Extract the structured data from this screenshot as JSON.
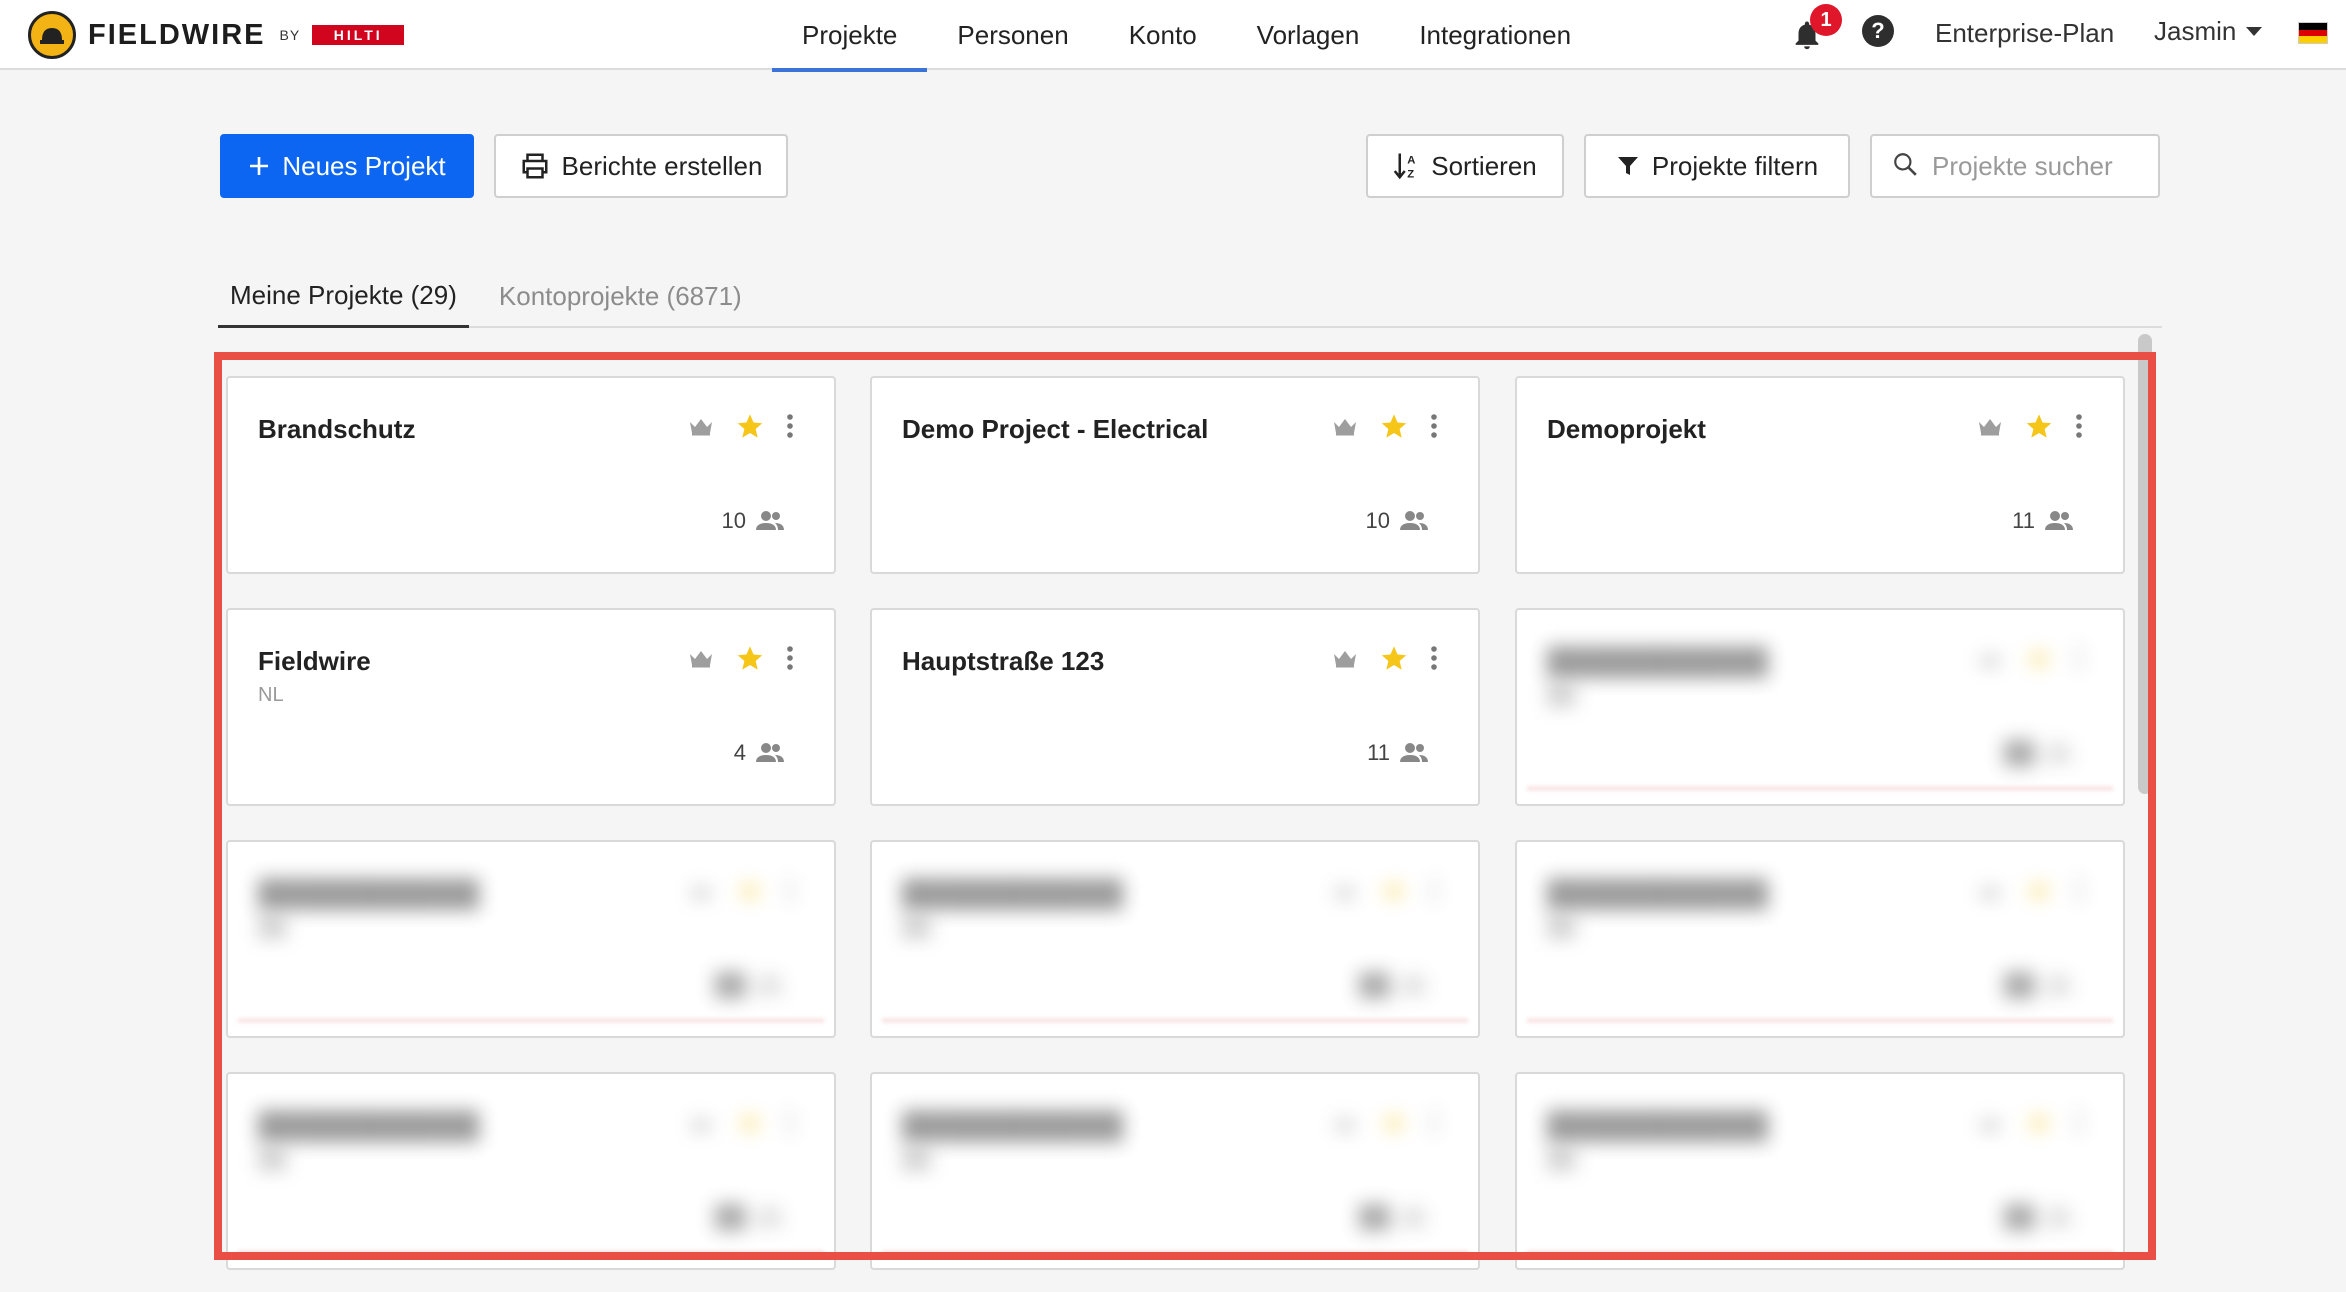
{
  "brand": {
    "name": "FIELDWIRE",
    "by": "BY",
    "partner": "HILTI"
  },
  "nav": {
    "items": [
      "Projekte",
      "Personen",
      "Konto",
      "Vorlagen",
      "Integrationen"
    ],
    "active": "Projekte"
  },
  "header_right": {
    "notification_count": "1",
    "help": "?",
    "plan": "Enterprise-Plan",
    "user": "Jasmin",
    "language_flag": "de"
  },
  "toolbar": {
    "new_project": "Neues Projekt",
    "reports": "Berichte erstellen",
    "sort": "Sortieren",
    "filter": "Projekte filtern",
    "search_placeholder": "Projekte sucher"
  },
  "tabs": [
    {
      "label": "Meine Projekte (29)",
      "active": true
    },
    {
      "label": "Kontoprojekte (6871)",
      "active": false
    }
  ],
  "projects": [
    {
      "name": "Brandschutz",
      "subtitle": "",
      "members": "10",
      "starred": true
    },
    {
      "name": "Demo Project - Electrical",
      "subtitle": "",
      "members": "10",
      "starred": true
    },
    {
      "name": "Demoprojekt",
      "subtitle": "",
      "members": "11",
      "starred": true
    },
    {
      "name": "Fieldwire",
      "subtitle": "NL",
      "members": "4",
      "starred": true
    },
    {
      "name": "Hauptstraße 123",
      "subtitle": "",
      "members": "11",
      "starred": true
    }
  ],
  "blurred_placeholder": {
    "name": "████████████",
    "subtitle": "██",
    "members": "██"
  },
  "colors": {
    "primary": "#0d66f2",
    "star": "#f5c518",
    "highlight_frame": "#e94f44",
    "notification": "#e0162b"
  }
}
